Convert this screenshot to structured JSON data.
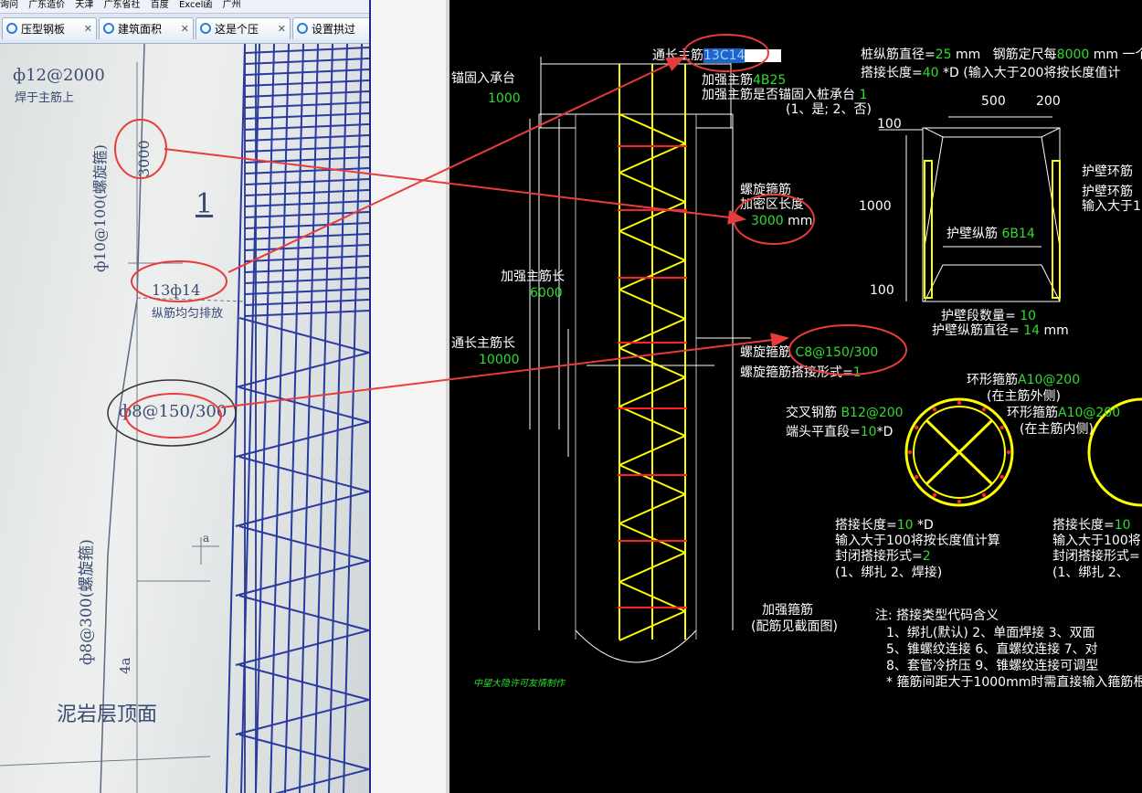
{
  "browser": {
    "favorites": [
      "询问",
      "广东造价",
      "天津",
      "广东省社",
      "百度",
      "Excel函",
      "广州"
    ],
    "tabs": [
      "压型钢板",
      "建筑面积",
      "这是个压",
      "设置拱过"
    ]
  },
  "photo": {
    "top_note": "ф12@2000",
    "top_note2": "焊于主筋上",
    "spiral_label": "ф10@100(螺旋箍)",
    "len_3000": "3000",
    "section_num": "1",
    "main_bar": "13ф14",
    "main_bar_note": "纵筋均匀排放",
    "stirrup": "ф8@150/300",
    "lower_spiral": "ф8@300(螺旋箍)",
    "dim_a": "a",
    "dim_4a": "4a",
    "bottom_text": "泥岩层顶面"
  },
  "cad": {
    "main_bar_label": "通长主筋",
    "main_bar_value": "13C14",
    "anchor_label": "锚固入承台",
    "anchor_value": "1000",
    "add_bar_label": "加强主筋",
    "add_bar_value": "4B25",
    "add_anchor_label": "加强主筋是否锚固入桩承台",
    "add_anchor_value": "1",
    "add_anchor_options": "(1、是; 2、否)",
    "pile_dia_label": "桩纵筋直径=",
    "pile_dia_value": "25",
    "mm": "mm",
    "pile_spacing_label": "钢筋定尺每",
    "pile_spacing_value": "8000",
    "pile_spacing_tail": "mm 一个",
    "lap_label": "搭接长度=",
    "lap_value": "40",
    "lap_tail": "*D (输入大于200将按长度值计",
    "spiral_label": "螺旋箍筋",
    "dense_label": "加密区长度",
    "dense_value": "3000",
    "add_len_label": "加强主筋长",
    "add_len_value": "6000",
    "total_len_label": "通长主筋长",
    "total_len_value": "10000",
    "spiral_stirrup_label": "螺旋箍筋",
    "spiral_stirrup_value": "C8@150/300",
    "spiral_lap_label": "螺旋箍筋搭接形式=",
    "spiral_lap_value": "1",
    "reinf_stirrup_label": "加强箍筋",
    "reinf_stirrup_note": "(配筋见截面图)",
    "credit": "中望大隐许可友情制作",
    "dim_500": "500",
    "dim_200": "200",
    "dim_100a": "100",
    "dim_1000": "1000",
    "dim_100b": "100",
    "wall_ring_label": "护壁环筋",
    "wall_ring_label2": "护壁环筋",
    "wall_ring_label3": "输入大于1",
    "wall_long_label": "护壁纵筋",
    "wall_long_value": "6B14",
    "wall_count_label": "护壁段数量=",
    "wall_count_value": "10",
    "wall_dia_label": "护壁纵筋直径=",
    "wall_dia_value": "14",
    "ring_outer_label": "环形箍筋",
    "ring_outer_value": "A10@200",
    "ring_outer_note": "(在主筋外侧)",
    "cross_label": "交叉钢筋",
    "cross_value": "B12@200",
    "ring_inner_label": "环形箍筋",
    "ring_inner_value": "A10@200",
    "ring_inner_note": "(在主筋内侧)",
    "end_straight_label": "端头平直段=",
    "end_straight_value": "10",
    "end_straight_tail": "*D",
    "lap2_label": "搭接长度=",
    "lap2_value": "10",
    "lap2_tail": "*D",
    "lap2_note": "输入大于100将按长度值计算",
    "close_lap_label": "封闭搭接形式=",
    "close_lap_value": "2",
    "close_lap_options": "(1、绑扎  2、焊接)",
    "lap3_label": "搭接长度=",
    "lap3_value": "10",
    "lap3_note": "输入大于100将",
    "close3_label": "封闭搭接形式=",
    "close3_options": "(1、绑扎  2、",
    "notes_title": "注: 搭接类型代码含义",
    "notes": [
      "1、绑扎(默认)    2、单面焊接    3、双面",
      "5、锥螺纹连接    6、直螺纹连接    7、对",
      "8、套管冷挤压    9、锥螺纹连接可调型",
      "* 箍筋间距大于1000mm时需直接输入箍筋根"
    ]
  },
  "colors": {
    "cad_bg": "#000000",
    "cad_text": "#ffffff",
    "cad_value": "#2fdc2f",
    "rebar_yellow": "#ffff00",
    "stirrup_red": "#ff2020",
    "annotation_red": "#e83c3c",
    "selection": "#1e63c9"
  }
}
